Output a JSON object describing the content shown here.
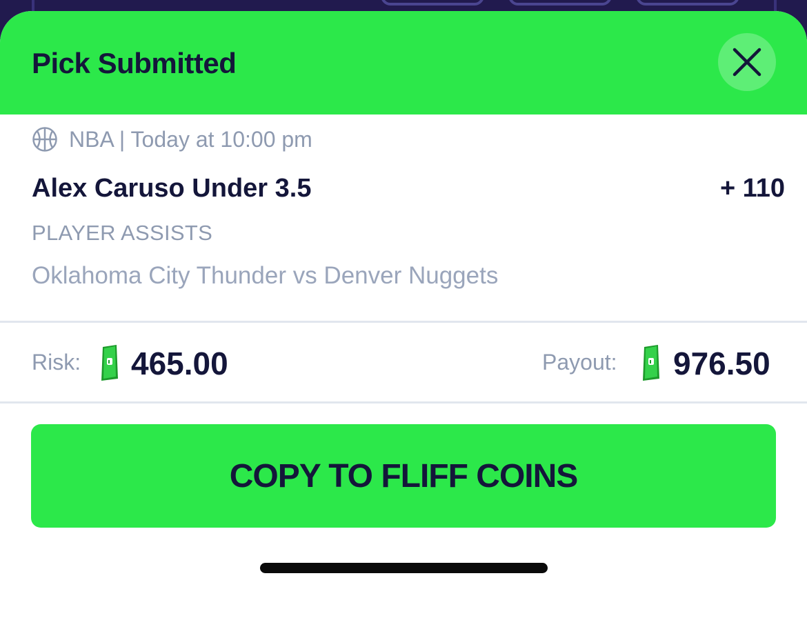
{
  "modal": {
    "title": "Pick Submitted",
    "close_icon": "close-icon"
  },
  "pick": {
    "sport_icon": "basketball-icon",
    "meta": "NBA | Today at 10:00 pm",
    "title": "Alex Caruso Under 3.5",
    "odds": "+ 110",
    "market": "PLAYER ASSISTS",
    "matchup": "Oklahoma City Thunder vs Denver Nuggets"
  },
  "wager": {
    "risk_label": "Risk:",
    "risk_amount": "465.00",
    "payout_label": "Payout:",
    "payout_amount": "976.50",
    "currency_icon": "cash-coin-icon"
  },
  "actions": {
    "copy_label": "COPY TO FLIFF COINS"
  },
  "colors": {
    "accent_green": "#2ce84a",
    "text_dark": "#14163a",
    "text_muted": "#8e9ab0",
    "background": "#211a4e"
  }
}
